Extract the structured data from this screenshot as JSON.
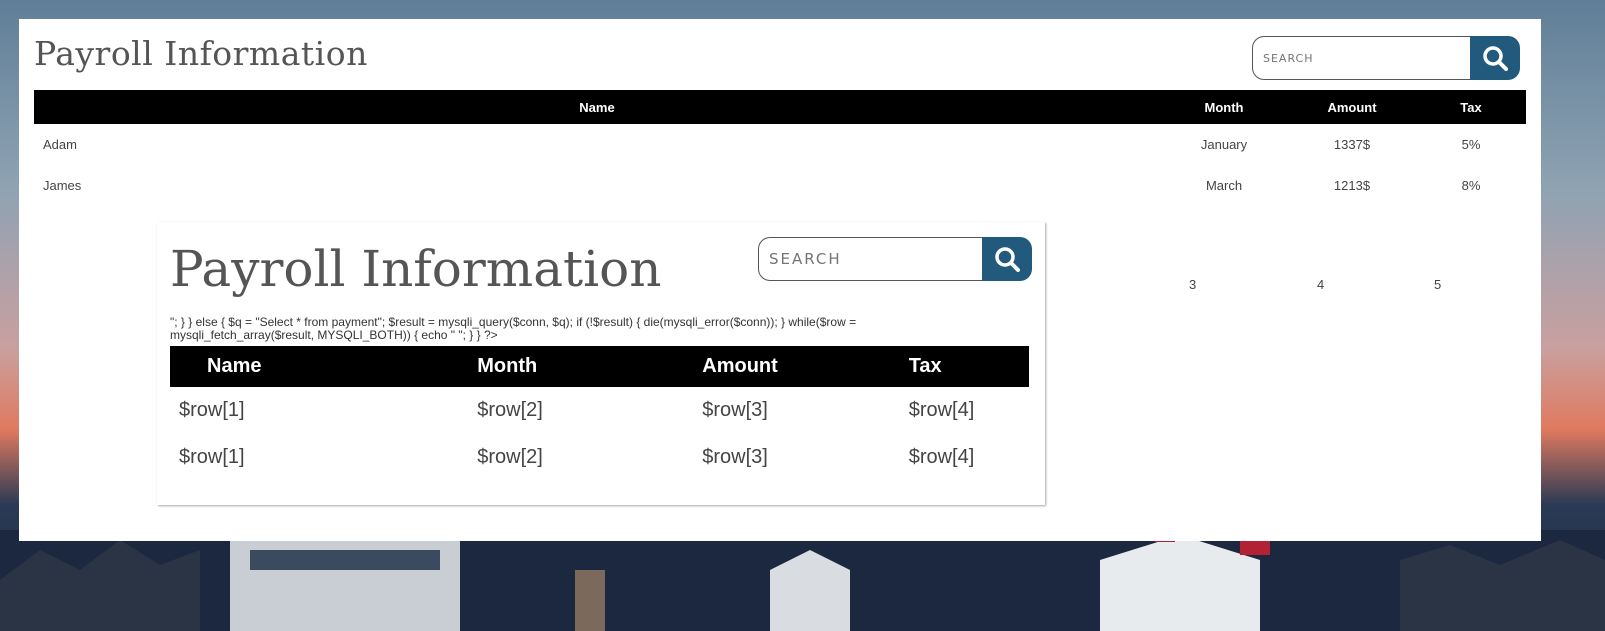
{
  "outer": {
    "title": "Payroll Information",
    "search_placeholder": "SEARCH",
    "columns": [
      "Name",
      "Month",
      "Amount",
      "Tax"
    ],
    "rows": [
      {
        "name": "Adam",
        "month": "January",
        "amount": "1337$",
        "tax": "5%"
      },
      {
        "name": "James",
        "month": "March",
        "amount": "1213$",
        "tax": "8%"
      }
    ],
    "extra_cells": [
      "3",
      "4",
      "5"
    ]
  },
  "inner": {
    "title": "Payroll Information",
    "search_placeholder": "SEARCH",
    "code_text": "\"; } } else { $q = \"Select * from payment\"; $result = mysqli_query($conn, $q); if (!$result) { die(mysqli_error($conn)); } while($row = mysqli_fetch_array($result, MYSQLI_BOTH)) { echo \" \"; } } ?>",
    "columns": [
      "Name",
      "Month",
      "Amount",
      "Tax"
    ],
    "rows": [
      {
        "name": "$row[1]",
        "month": "$row[2]",
        "amount": "$row[3]",
        "tax": "$row[4]"
      },
      {
        "name": "$row[1]",
        "month": "$row[2]",
        "amount": "$row[3]",
        "tax": "$row[4]"
      }
    ]
  },
  "icons": {
    "search": "search-icon"
  },
  "colors": {
    "search_button": "#215a7d",
    "table_header": "#000000"
  }
}
